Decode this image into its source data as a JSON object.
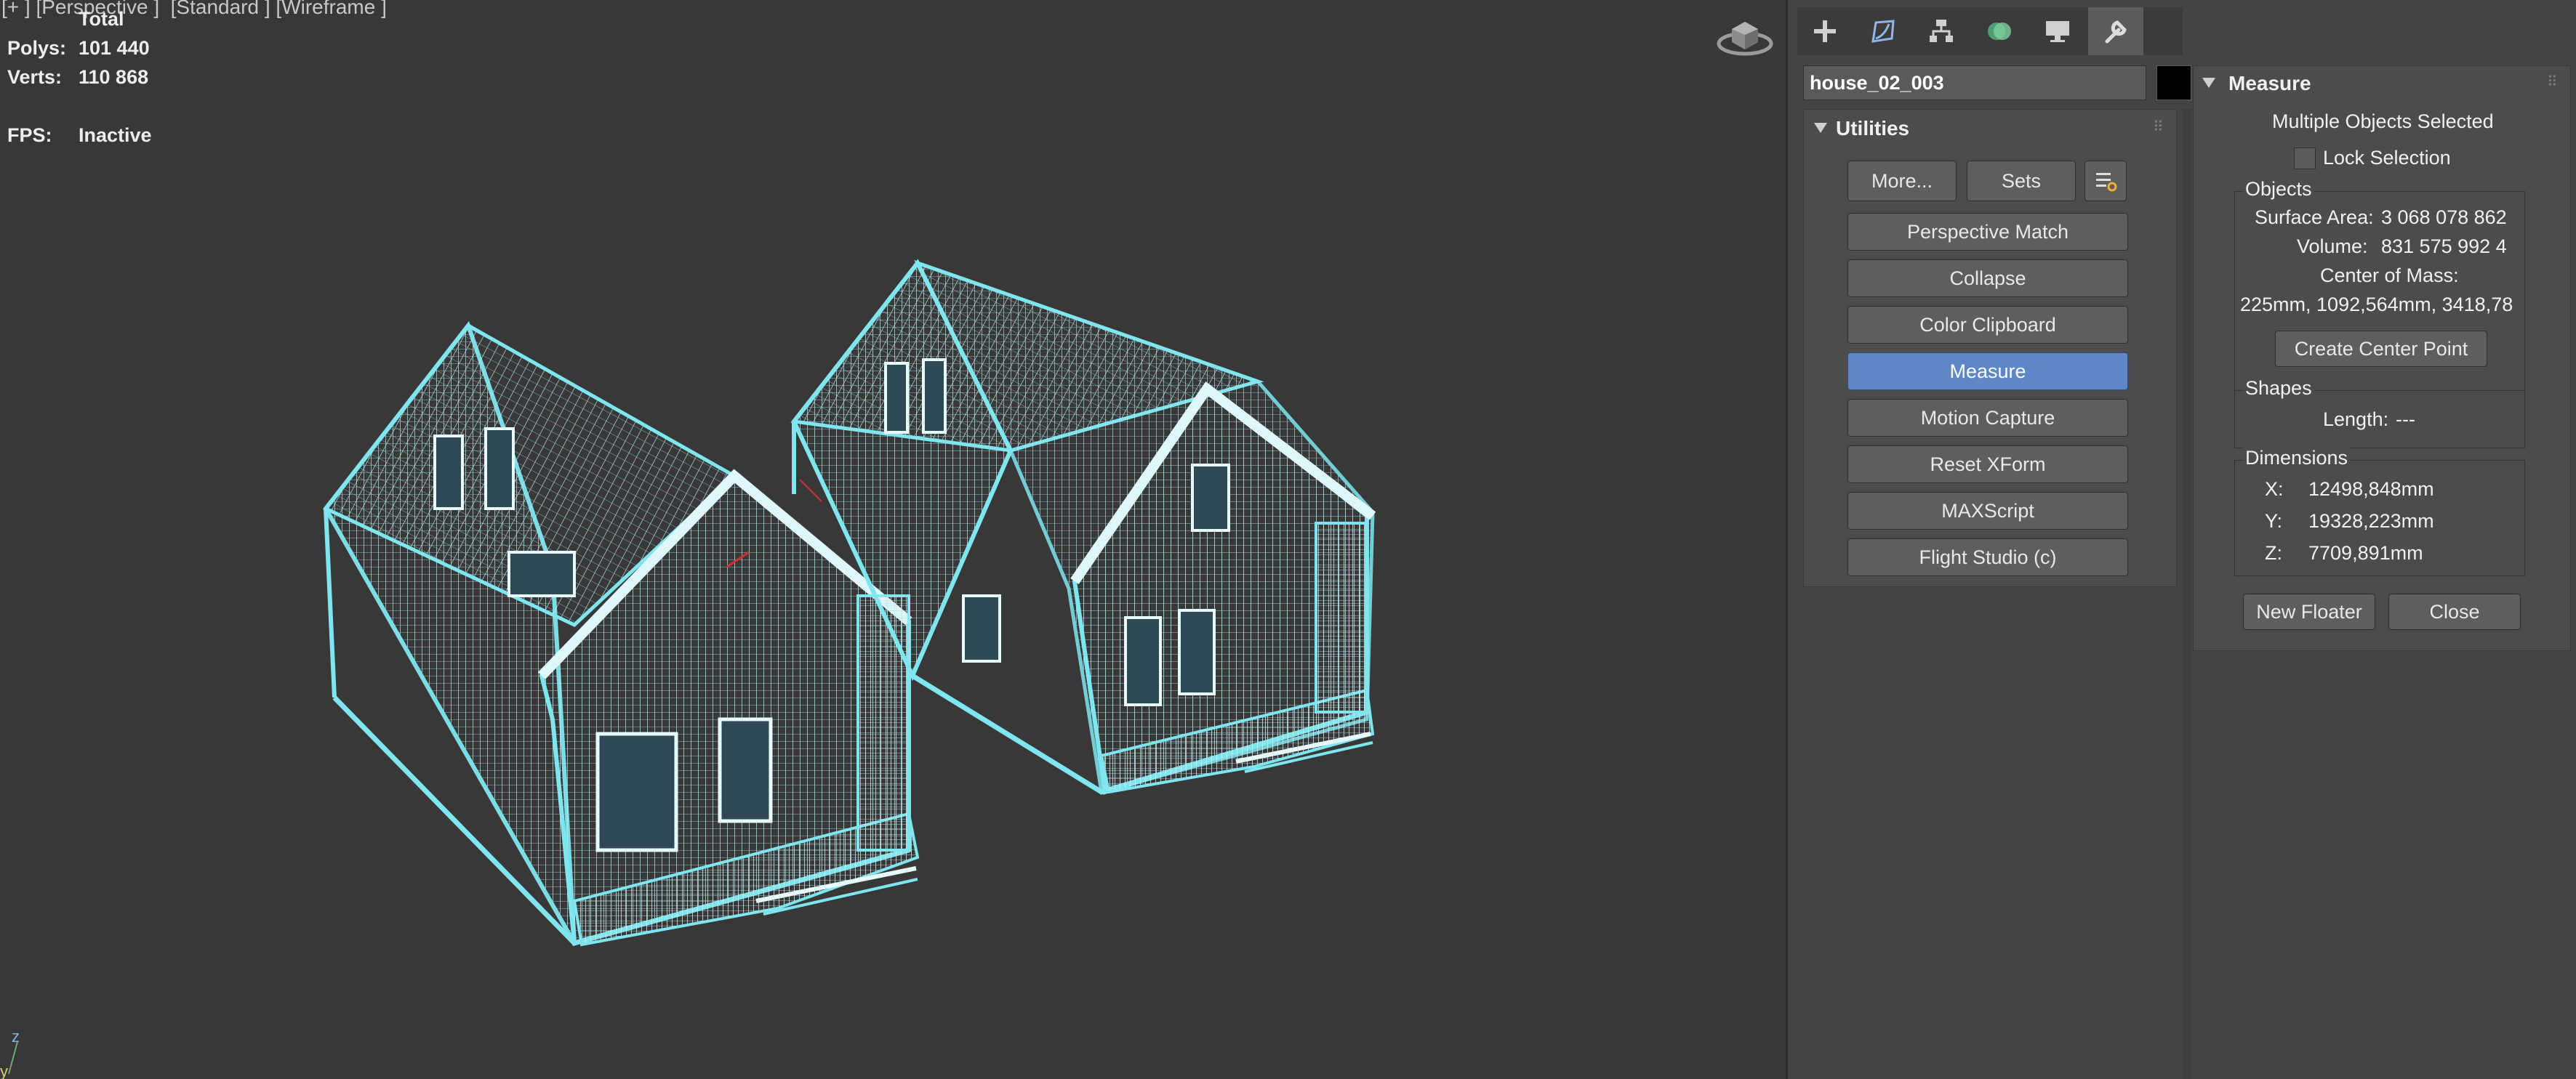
{
  "viewport": {
    "label": "[+ ] [Perspective ]  [Standard ] [Wireframe ]",
    "stats": {
      "total_label": "Total",
      "polys_label": "Polys:",
      "polys_value": "101 440",
      "verts_label": "Verts:",
      "verts_value": "110 868",
      "fps_label": "FPS:",
      "fps_value": "Inactive"
    },
    "axis": {
      "z": "z",
      "y": "y"
    },
    "wire_color": "#7fe6f0",
    "bg_color": "#383838"
  },
  "command_panel": {
    "tabs": [
      {
        "icon": "plus-icon",
        "label": "Create"
      },
      {
        "icon": "modify-icon",
        "label": "Modify"
      },
      {
        "icon": "hierarchy-icon",
        "label": "Hierarchy"
      },
      {
        "icon": "motion-icon",
        "label": "Motion"
      },
      {
        "icon": "display-icon",
        "label": "Display"
      },
      {
        "icon": "wrench-icon",
        "label": "Utilities",
        "active": true
      }
    ],
    "object_name": "house_02_003",
    "object_color": "#000000"
  },
  "utilities": {
    "title": "Utilities",
    "more_label": "More...",
    "sets_label": "Sets",
    "items": [
      {
        "label": "Perspective Match"
      },
      {
        "label": "Collapse"
      },
      {
        "label": "Color Clipboard"
      },
      {
        "label": "Measure",
        "active": true
      },
      {
        "label": "Motion Capture"
      },
      {
        "label": "Reset XForm"
      },
      {
        "label": "MAXScript"
      },
      {
        "label": "Flight Studio (c)"
      }
    ],
    "active_color": "#5d87c7"
  },
  "measure": {
    "title": "Measure",
    "selection_text": "Multiple Objects Selected",
    "lock_selection_label": "Lock Selection",
    "objects_group": "Objects",
    "surface_area_label": "Surface Area:",
    "surface_area_value": "3 068 078 862",
    "volume_label": "Volume:",
    "volume_value": "831 575 992 4",
    "center_of_mass_label": "Center of Mass:",
    "center_of_mass_value": "225mm, 1092,564mm, 3418,78",
    "create_center_point_label": "Create Center Point",
    "shapes_group": "Shapes",
    "length_label": "Length:",
    "length_value": "---",
    "dimensions_group": "Dimensions",
    "x_label": "X:",
    "x_value": "12498,848mm",
    "y_label": "Y:",
    "y_value": "19328,223mm",
    "z_label": "Z:",
    "z_value": "7709,891mm",
    "new_floater_label": "New Floater",
    "close_label": "Close"
  }
}
